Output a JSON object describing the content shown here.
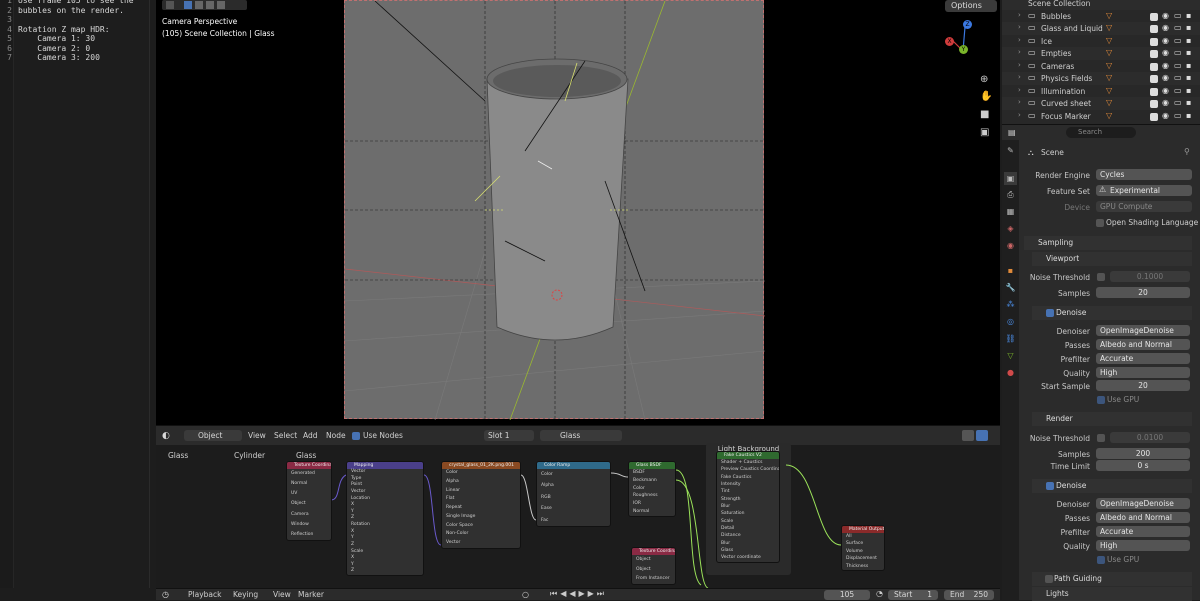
{
  "text_editor": {
    "lines": [
      {
        "n": "1",
        "t": "Use frame 105 to see the"
      },
      {
        "n": "2",
        "t": "bubbles on the render."
      },
      {
        "n": "3",
        "t": ""
      },
      {
        "n": "4",
        "t": "Rotation Z map HDR:"
      },
      {
        "n": "5",
        "t": "    Camera 1: 30"
      },
      {
        "n": "6",
        "t": "    Camera 2: 0"
      },
      {
        "n": "7",
        "t": "    Camera 3: 200"
      }
    ]
  },
  "viewport": {
    "title": "Camera Perspective",
    "subtitle": "(105) Scene Collection | Glass",
    "options_label": "Options",
    "gizmo": {
      "z": "Z",
      "y": "Y",
      "x": "X"
    }
  },
  "node_editor": {
    "object_mode": "Object",
    "menus": [
      "View",
      "Select",
      "Add",
      "Node"
    ],
    "use_nodes_label": "Use Nodes",
    "slot": "Slot 1",
    "material": "Glass",
    "breadcrumb": [
      "Glass",
      "Cylinder",
      "Glass"
    ],
    "frame_label": "Light Background",
    "nodes": [
      {
        "title": "Texture Coordinate",
        "color": "#8a2a44",
        "rows": [
          "Generated",
          "Normal",
          "UV",
          "Object",
          "Camera",
          "Window",
          "Reflection"
        ]
      },
      {
        "title": "Mapping",
        "color": "#4a3f8a",
        "rows": [
          "Vector",
          "Type",
          "Point",
          "Vector",
          "Location",
          "X",
          "Y",
          "Z",
          "Rotation",
          "X",
          "Y",
          "Z",
          "Scale",
          "X",
          "Y",
          "Z"
        ]
      },
      {
        "title": "crystal_glass_01_2K.png.001",
        "color": "#8a4a22",
        "rows": [
          "Color",
          "Alpha",
          "Linear",
          "Flat",
          "Repeat",
          "Single Image",
          "Color Space",
          "Non-Color",
          "Vector"
        ]
      },
      {
        "title": "Color Ramp",
        "color": "#2f6a8a",
        "rows": [
          "Color",
          "Alpha",
          "RGB",
          "Ease",
          "Fac"
        ]
      },
      {
        "title": "Glass BSDF",
        "color": "#2f6a2f",
        "rows": [
          "BSDF",
          "Beckmann",
          "Color",
          "Roughness",
          "IOR",
          "Normal"
        ]
      },
      {
        "title": "Fake Caustics V2",
        "color": "#2f6a2f",
        "rows": [
          "Shader + Caustics",
          "Preview Caustics Coordinate",
          "Fake Caustics",
          "Intensity",
          "Tint",
          "Strength",
          "Blur",
          "Saturation",
          "Scale",
          "Detail",
          "Distance",
          "Blur",
          "Glass",
          "Vector coordinate"
        ]
      },
      {
        "title": "Material Output",
        "color": "#8a2a2a",
        "rows": [
          "All",
          "Surface",
          "Volume",
          "Displacement",
          "Thickness"
        ]
      },
      {
        "title": "Texture Coordinate",
        "color": "#8a2a44",
        "rows": [
          "Object",
          "Object",
          "From Instancer"
        ]
      }
    ]
  },
  "timeline": {
    "menus": [
      "Playback",
      "Keying",
      "View",
      "Marker"
    ],
    "current_frame": "105",
    "start_label": "Start",
    "start": "1",
    "end_label": "End",
    "end": "250"
  },
  "outliner": {
    "title": "Scene Collection",
    "items": [
      "Bubbles",
      "Glass and Liquid",
      "Ice",
      "Empties",
      "Cameras",
      "Physics Fields",
      "Illumination",
      "Curved sheet",
      "Focus Marker"
    ]
  },
  "properties": {
    "search_placeholder": "Search",
    "scene_label": "Scene",
    "render_engine_label": "Render Engine",
    "render_engine": "Cycles",
    "feature_set_label": "Feature Set",
    "feature_set": "Experimental",
    "device_label": "Device",
    "device": "GPU Compute",
    "open_shading": "Open Shading Language",
    "sampling": "Sampling",
    "viewport": "Viewport",
    "noise_threshold_label": "Noise Threshold",
    "vp_noise_threshold": "0.1000",
    "samples_label": "Samples",
    "vp_samples": "20",
    "denoise_label": "Denoise",
    "denoiser_label": "Denoiser",
    "denoiser": "OpenImageDenoise",
    "passes_label": "Passes",
    "passes": "Albedo and Normal",
    "prefilter_label": "Prefilter",
    "prefilter": "Accurate",
    "quality_label": "Quality",
    "quality": "High",
    "start_sample_label": "Start Sample",
    "start_sample": "20",
    "use_gpu": "Use GPU",
    "render": "Render",
    "r_noise_threshold": "0.0100",
    "r_samples": "200",
    "time_limit_label": "Time Limit",
    "time_limit": "0 s",
    "path_guiding": "Path Guiding",
    "lights": "Lights"
  }
}
